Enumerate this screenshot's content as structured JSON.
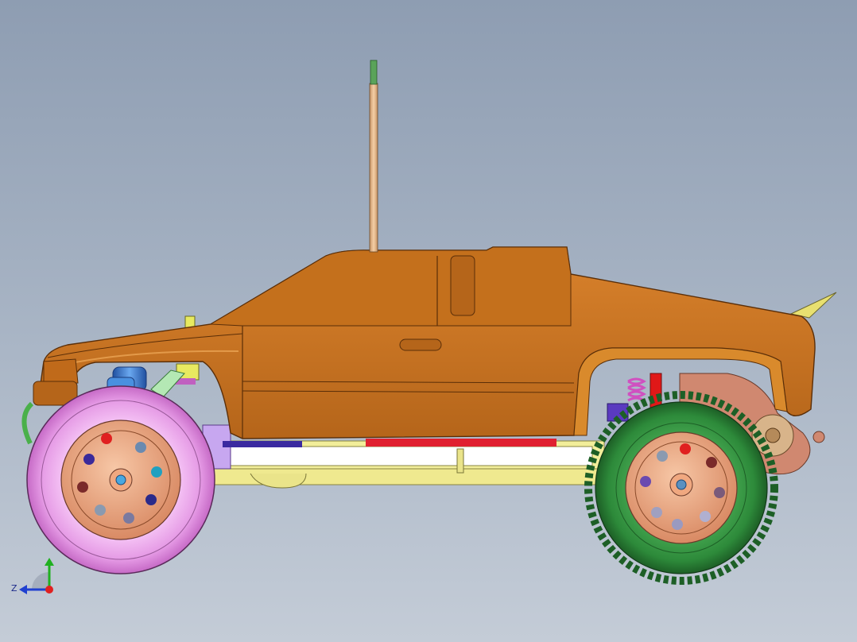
{
  "app": {
    "window_kind": "cad-3d-viewport",
    "view": "side",
    "background_top": "#8e9db2",
    "background_bottom": "#c4ccd7"
  },
  "model": {
    "subject": "rc-truck-assembly",
    "colors": {
      "body": "#c8731f",
      "body_dark": "#8a4a10",
      "body_light": "#e39a4a",
      "antenna": "#e8b987",
      "antenna_tip": "#5aa35a",
      "front_tire": "#eaa0ea",
      "rear_tire": "#2d8a3a",
      "rim": "#e8a07a",
      "chassis": "#f2ee9a",
      "chassis_dark": "#b8b060",
      "shock_front": "#3a7ad0",
      "shock_rear": "#d050c0",
      "accent_red": "#e02020",
      "rear_housing": "#d08870",
      "wing": "#e8e070"
    }
  },
  "triad": {
    "z_label": "Z",
    "icon": "axis-triad-icon",
    "x_color": "#e02020",
    "y_color": "#20b020",
    "z_color": "#2040d0"
  }
}
